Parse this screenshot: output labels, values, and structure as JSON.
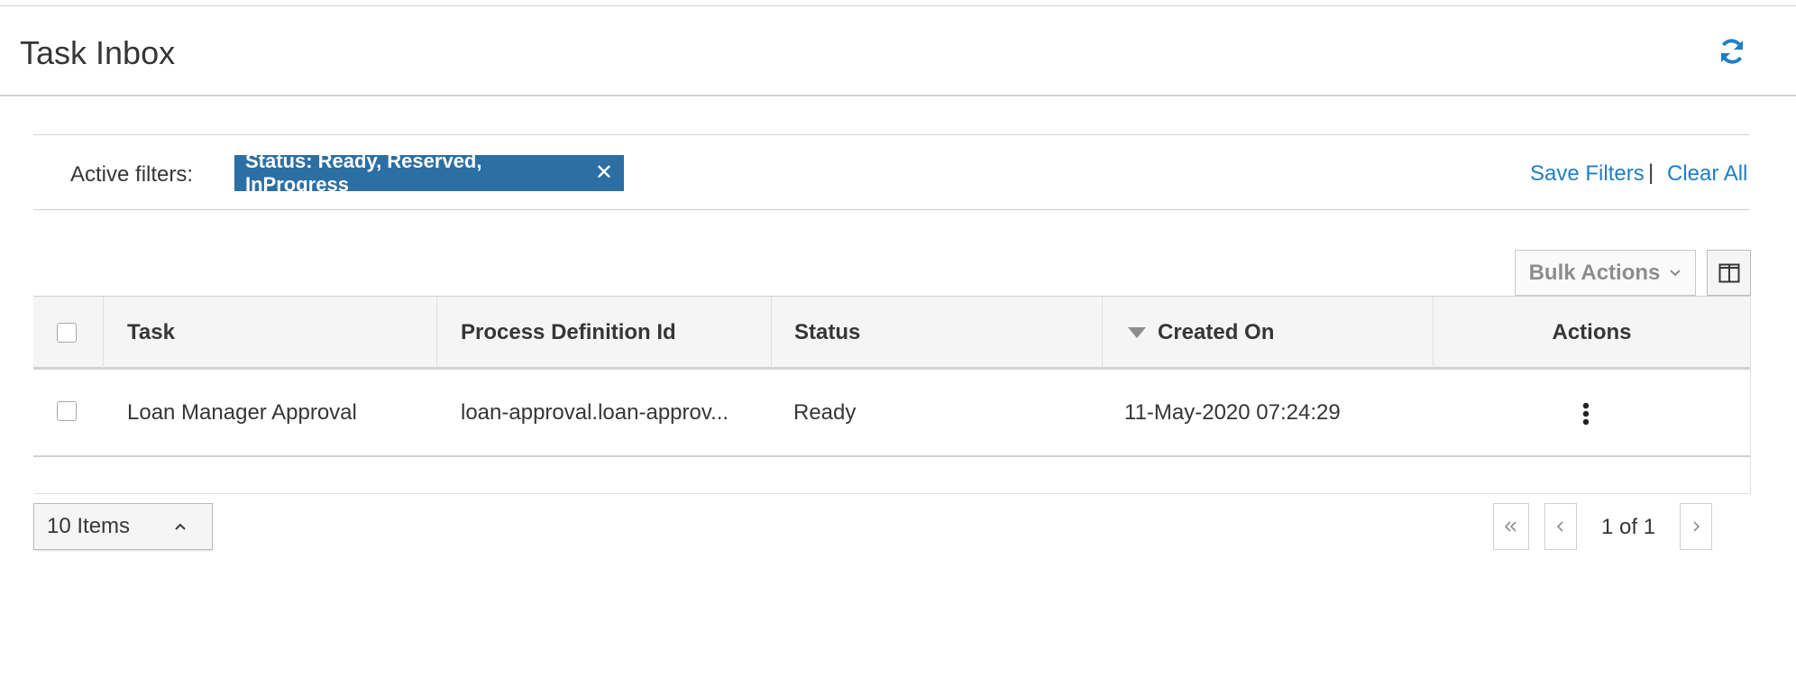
{
  "header": {
    "title": "Task Inbox",
    "refresh_icon": "refresh-icon"
  },
  "filters": {
    "label": "Active filters:",
    "chip_text": "Status: Ready, Reserved, InProgress",
    "chip_close": "✕",
    "save_label": "Save Filters",
    "separator": "|",
    "clear_label": "Clear All"
  },
  "toolbar": {
    "bulk_actions_label": "Bulk Actions",
    "columns_icon": "columns-icon"
  },
  "table": {
    "columns": [
      "Task",
      "Process Definition Id",
      "Status",
      "Created On",
      "Actions"
    ],
    "sorted_column": "Created On",
    "rows": [
      {
        "task": "Loan Manager Approval",
        "process_definition_id": "loan-approval.loan-approv...",
        "status": "Ready",
        "created_on": "11-May-2020 07:24:29"
      }
    ]
  },
  "pagination": {
    "per_page_label": "10 Items",
    "page_text": "1 of 1"
  },
  "colors": {
    "chip_bg": "#2b6fa4",
    "link": "#1f7fc3",
    "refresh_icon": "#1f7fc3"
  }
}
